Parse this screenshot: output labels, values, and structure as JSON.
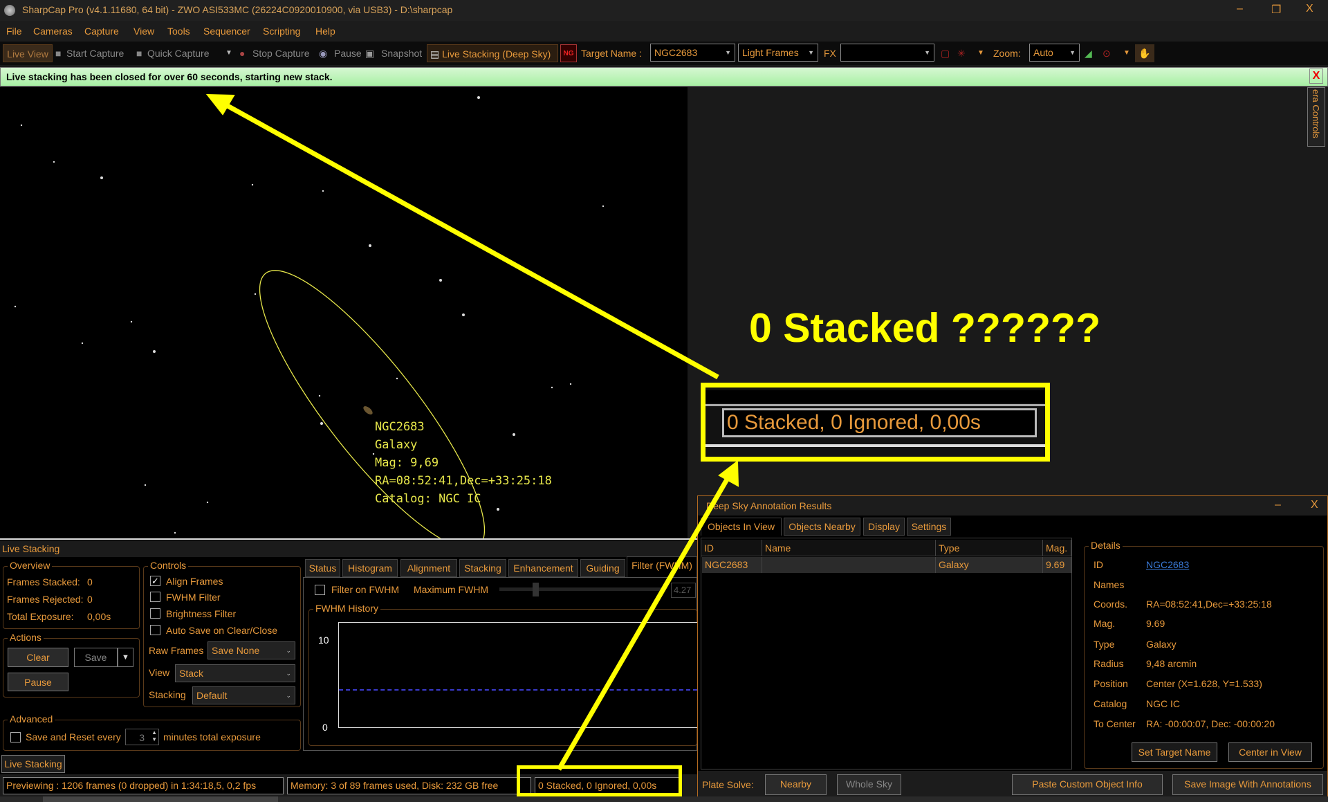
{
  "window": {
    "title": "SharpCap Pro (v4.1.11680, 64 bit) - ZWO ASI533MC (26224C0920010900, via USB3) - D:\\sharpcap",
    "minimize": "–",
    "restore": "❐",
    "close": "X"
  },
  "menu": [
    "File",
    "Cameras",
    "Capture",
    "View",
    "Tools",
    "Sequencer",
    "Scripting",
    "Help"
  ],
  "toolbar": {
    "live_view": "Live View",
    "start_capture": "Start Capture",
    "quick_capture": "Quick Capture",
    "stop_capture": "Stop Capture",
    "pause": "Pause",
    "snapshot": "Snapshot",
    "live_stacking": "Live Stacking (Deep Sky)",
    "ng_icon_text": "NG",
    "target_label": "Target Name :",
    "target_value": "NGC2683",
    "frame_type": "Light Frames",
    "fx_label": "FX",
    "fx_value": "",
    "zoom_label": "Zoom:",
    "zoom_value": "Auto"
  },
  "banner": {
    "message": "Live stacking has been closed for over 60 seconds, starting new stack.",
    "close": "X"
  },
  "camera_controls_tab": "era Controls",
  "viewer_annotation": {
    "lines": [
      "NGC2683",
      "Galaxy",
      "Mag: 9,69",
      "RA=08:52:41,Dec=+33:25:18",
      "Catalog: NGC IC"
    ]
  },
  "callout": {
    "headline": "0 Stacked ??????",
    "zoomed_status": "0 Stacked, 0 Ignored, 0,00s",
    "color": "#ffff00"
  },
  "live_stacking": {
    "header": "Live Stacking",
    "overview": {
      "title": "Overview",
      "frames_stacked_label": "Frames Stacked:",
      "frames_stacked": "0",
      "frames_rejected_label": "Frames Rejected:",
      "frames_rejected": "0",
      "total_exposure_label": "Total Exposure:",
      "total_exposure": "0,00s"
    },
    "actions": {
      "title": "Actions",
      "clear": "Clear",
      "save": "Save",
      "pause": "Pause"
    },
    "controls": {
      "title": "Controls",
      "align_frames": "Align Frames",
      "align_checked": true,
      "fwhm_filter": "FWHM Filter",
      "brightness_filter": "Brightness Filter",
      "auto_save": "Auto Save on Clear/Close",
      "raw_frames_label": "Raw Frames",
      "raw_frames": "Save None",
      "view_label": "View",
      "view": "Stack",
      "stacking_label": "Stacking",
      "stacking": "Default"
    },
    "advanced": {
      "title": "Advanced",
      "save_reset_label": "Save and Reset every",
      "minutes": "3",
      "suffix": "minutes total exposure"
    },
    "tabs": [
      "Status",
      "Histogram",
      "Alignment",
      "Stacking",
      "Enhancement",
      "Guiding",
      "Filter (FWHM)"
    ],
    "active_tab": "Filter (FWHM)",
    "filter": {
      "filter_on_fwhm": "Filter on FWHM",
      "max_fwhm_label": "Maximum FWHM",
      "max_fwhm": "4.27",
      "history_title": "FWHM History",
      "y_max": "10",
      "y_min": "0"
    },
    "bottom_tab": "Live Stacking"
  },
  "status_bar": {
    "previewing": "Previewing : 1206 frames (0 dropped) in 1:34:18,5, 0,2 fps",
    "memory": "Memory: 3 of 89 frames used, Disk: 232 GB free",
    "stack": "0 Stacked, 0 Ignored, 0,00s"
  },
  "deep_sky": {
    "title": "Deep Sky Annotation Results",
    "minimize": "–",
    "close": "X",
    "tabs": [
      "Objects In View",
      "Objects Nearby",
      "Display",
      "Settings"
    ],
    "columns": [
      "ID",
      "Name",
      "Type",
      "Mag."
    ],
    "rows": [
      {
        "id": "NGC2683",
        "name": "",
        "type": "Galaxy",
        "mag": "9.69"
      }
    ],
    "details": {
      "title": "Details",
      "fields": [
        {
          "label": "ID",
          "value": "NGC2683"
        },
        {
          "label": "Names",
          "value": ""
        },
        {
          "label": "Coords.",
          "value": "RA=08:52:41,Dec=+33:25:18"
        },
        {
          "label": "Mag.",
          "value": "9.69"
        },
        {
          "label": "Type",
          "value": "Galaxy"
        },
        {
          "label": "Radius",
          "value": "9,48 arcmin"
        },
        {
          "label": "Position",
          "value": "Center (X=1.628, Y=1.533)"
        },
        {
          "label": "Catalog",
          "value": "NGC IC"
        },
        {
          "label": "To Center",
          "value": "RA: -00:00:07, Dec: -00:00:20"
        }
      ],
      "set_target": "Set Target Name",
      "center_in_view": "Center in View"
    },
    "plate_solve_label": "Plate Solve:",
    "nearby": "Nearby",
    "whole_sky": "Whole Sky",
    "paste_custom": "Paste Custom Object Info",
    "save_image": "Save Image With Annotations"
  }
}
